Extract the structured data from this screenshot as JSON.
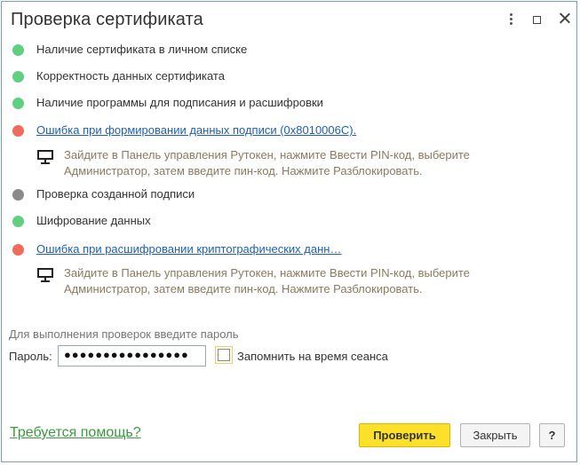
{
  "window": {
    "title": "Проверка сертификата"
  },
  "checks": [
    {
      "label": "Наличие сертификата в личном списке",
      "status": "ok",
      "color": "#5fcf80"
    },
    {
      "label": "Корректность данных сертификата",
      "status": "ok",
      "color": "#5fcf80"
    },
    {
      "label": "Наличие программы для подписания и расшифровки",
      "status": "ok",
      "color": "#5fcf80"
    },
    {
      "label": "Ошибка при формировании данных подписи (0x8010006C).",
      "status": "error",
      "color": "#ef6b5b",
      "hint_line1": "Зайдите в Панель управления Рутокен, нажмите Ввести PIN-код, выберите",
      "hint_line2": "Администратор, затем введите пин-код. Нажмите Разблокировать."
    },
    {
      "label": "Проверка созданной подписи",
      "status": "pending",
      "color": "#8a8a8a"
    },
    {
      "label": "Шифрование данных",
      "status": "ok",
      "color": "#5fcf80"
    },
    {
      "label": "Ошибка при расшифровании криптографических данн…",
      "status": "error",
      "color": "#ef6b5b",
      "hint_line1": "Зайдите в Панель управления Рутокен, нажмите Ввести PIN-код, выберите",
      "hint_line2": "Администратор, затем введите пин-код. Нажмите Разблокировать."
    }
  ],
  "password": {
    "prompt": "Для выполнения проверок введите пароль",
    "label": "Пароль:",
    "value": "●●●●●●●●●●●●●●●●",
    "remember_label": "Запомнить на время сеанса"
  },
  "footer": {
    "help_link": "Требуется помощь?",
    "check_button": "Проверить",
    "close_button": "Закрыть",
    "help_button": "?"
  }
}
